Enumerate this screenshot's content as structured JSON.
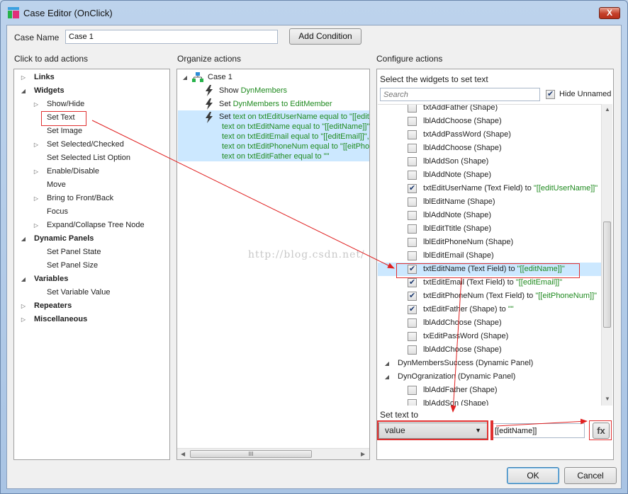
{
  "window": {
    "title": "Case Editor (OnClick)",
    "close_label": "X"
  },
  "case_name": {
    "label": "Case Name",
    "value": "Case 1",
    "add_condition": "Add Condition"
  },
  "left": {
    "header": "Click to add actions",
    "items": [
      {
        "label": "Links",
        "bold": true,
        "indent": 0,
        "arrow": "right"
      },
      {
        "label": "Widgets",
        "bold": true,
        "indent": 0,
        "arrow": "down"
      },
      {
        "label": "Show/Hide",
        "bold": false,
        "indent": 1,
        "arrow": "right"
      },
      {
        "label": "Set Text",
        "bold": false,
        "indent": 1,
        "arrow": ""
      },
      {
        "label": "Set Image",
        "bold": false,
        "indent": 1,
        "arrow": ""
      },
      {
        "label": "Set Selected/Checked",
        "bold": false,
        "indent": 1,
        "arrow": "right"
      },
      {
        "label": "Set Selected List Option",
        "bold": false,
        "indent": 1,
        "arrow": ""
      },
      {
        "label": "Enable/Disable",
        "bold": false,
        "indent": 1,
        "arrow": "right"
      },
      {
        "label": "Move",
        "bold": false,
        "indent": 1,
        "arrow": ""
      },
      {
        "label": "Bring to Front/Back",
        "bold": false,
        "indent": 1,
        "arrow": "right"
      },
      {
        "label": "Focus",
        "bold": false,
        "indent": 1,
        "arrow": ""
      },
      {
        "label": "Expand/Collapse Tree Node",
        "bold": false,
        "indent": 1,
        "arrow": "right"
      },
      {
        "label": "Dynamic Panels",
        "bold": true,
        "indent": 0,
        "arrow": "down"
      },
      {
        "label": "Set Panel State",
        "bold": false,
        "indent": 1,
        "arrow": ""
      },
      {
        "label": "Set Panel Size",
        "bold": false,
        "indent": 1,
        "arrow": ""
      },
      {
        "label": "Variables",
        "bold": true,
        "indent": 0,
        "arrow": "down"
      },
      {
        "label": "Set Variable Value",
        "bold": false,
        "indent": 1,
        "arrow": ""
      },
      {
        "label": "Repeaters",
        "bold": true,
        "indent": 0,
        "arrow": "right"
      },
      {
        "label": "Miscellaneous",
        "bold": true,
        "indent": 0,
        "arrow": "right"
      }
    ]
  },
  "middle": {
    "header": "Organize actions",
    "case_label": "Case 1",
    "actions": [
      {
        "verb": "Show",
        "target": "DynMembers"
      },
      {
        "verb": "Set",
        "target": "DynMembers to EditMember"
      }
    ],
    "set_text": {
      "verb": "Set",
      "lines": [
        "text on txtEditUserName equal to \"[[edit",
        "text on txtEditName equal to \"[[editName]]\",",
        "text on txtEditEmail equal to \"[[editEmail]]\", a",
        "text on txtEditPhoneNum equal to \"[[eitPho",
        "text on txtEditFather equal to \"\""
      ]
    },
    "hscroll_grip": "III"
  },
  "right": {
    "header": "Configure actions",
    "select_label": "Select the widgets to set text",
    "search_placeholder": "Search",
    "hide_unnamed": "Hide Unnamed",
    "widgets": [
      {
        "name": "txtAddFather (Shape)",
        "value": "",
        "checked": false,
        "indent": 2
      },
      {
        "name": "lblAddChoose (Shape)",
        "value": "",
        "checked": false,
        "indent": 2
      },
      {
        "name": "txtAddPassWord (Shape)",
        "value": "",
        "checked": false,
        "indent": 2
      },
      {
        "name": "lblAddChoose (Shape)",
        "value": "",
        "checked": false,
        "indent": 2
      },
      {
        "name": "lblAddSon (Shape)",
        "value": "",
        "checked": false,
        "indent": 2
      },
      {
        "name": "lblAddNote (Shape)",
        "value": "",
        "checked": false,
        "indent": 2
      },
      {
        "name": "txtEditUserName (Text Field) to ",
        "value": "\"[[editUserName]]\"",
        "checked": true,
        "indent": 2
      },
      {
        "name": "lblEditName (Shape)",
        "value": "",
        "checked": false,
        "indent": 2
      },
      {
        "name": "lblAddNote (Shape)",
        "value": "",
        "checked": false,
        "indent": 2
      },
      {
        "name": "lblEditTtitle (Shape)",
        "value": "",
        "checked": false,
        "indent": 2
      },
      {
        "name": "lblEditPhoneNum (Shape)",
        "value": "",
        "checked": false,
        "indent": 2
      },
      {
        "name": "lblEditEmail (Shape)",
        "value": "",
        "checked": false,
        "indent": 2
      },
      {
        "name": "txtEditName (Text Field) to ",
        "value": "\"[[editName]]\"",
        "checked": true,
        "indent": 2,
        "selected": true
      },
      {
        "name": "txtEditEmail (Text Field) to ",
        "value": "\"[[editEmail]]\"",
        "checked": true,
        "indent": 2
      },
      {
        "name": "txtEditPhoneNum (Text Field) to ",
        "value": "\"[[eitPhoneNum]]\"",
        "checked": true,
        "indent": 2
      },
      {
        "name": "txtEditFather (Shape) to ",
        "value": "\"\"",
        "checked": true,
        "indent": 2
      },
      {
        "name": "lblAddChoose (Shape)",
        "value": "",
        "checked": false,
        "indent": 2
      },
      {
        "name": "txEditPassWord (Shape)",
        "value": "",
        "checked": false,
        "indent": 2
      },
      {
        "name": "lblAddChoose (Shape)",
        "value": "",
        "checked": false,
        "indent": 2
      },
      {
        "name": "DynMembersSuccess (Dynamic Panel)",
        "value": "",
        "checked": null,
        "indent": 1
      },
      {
        "name": "DynOgranization (Dynamic Panel)",
        "value": "",
        "checked": null,
        "indent": 1
      },
      {
        "name": "lblAddFather (Shape)",
        "value": "",
        "checked": false,
        "indent": 2
      },
      {
        "name": "lblAddSon (Shape)",
        "value": "",
        "checked": false,
        "indent": 2
      }
    ],
    "set_text_to": "Set text to",
    "value_type": "value",
    "value_text": "[[editName]]",
    "fx_label": "fx"
  },
  "footer": {
    "ok": "OK",
    "cancel": "Cancel"
  },
  "watermark": "http://blog.csdn.net/"
}
